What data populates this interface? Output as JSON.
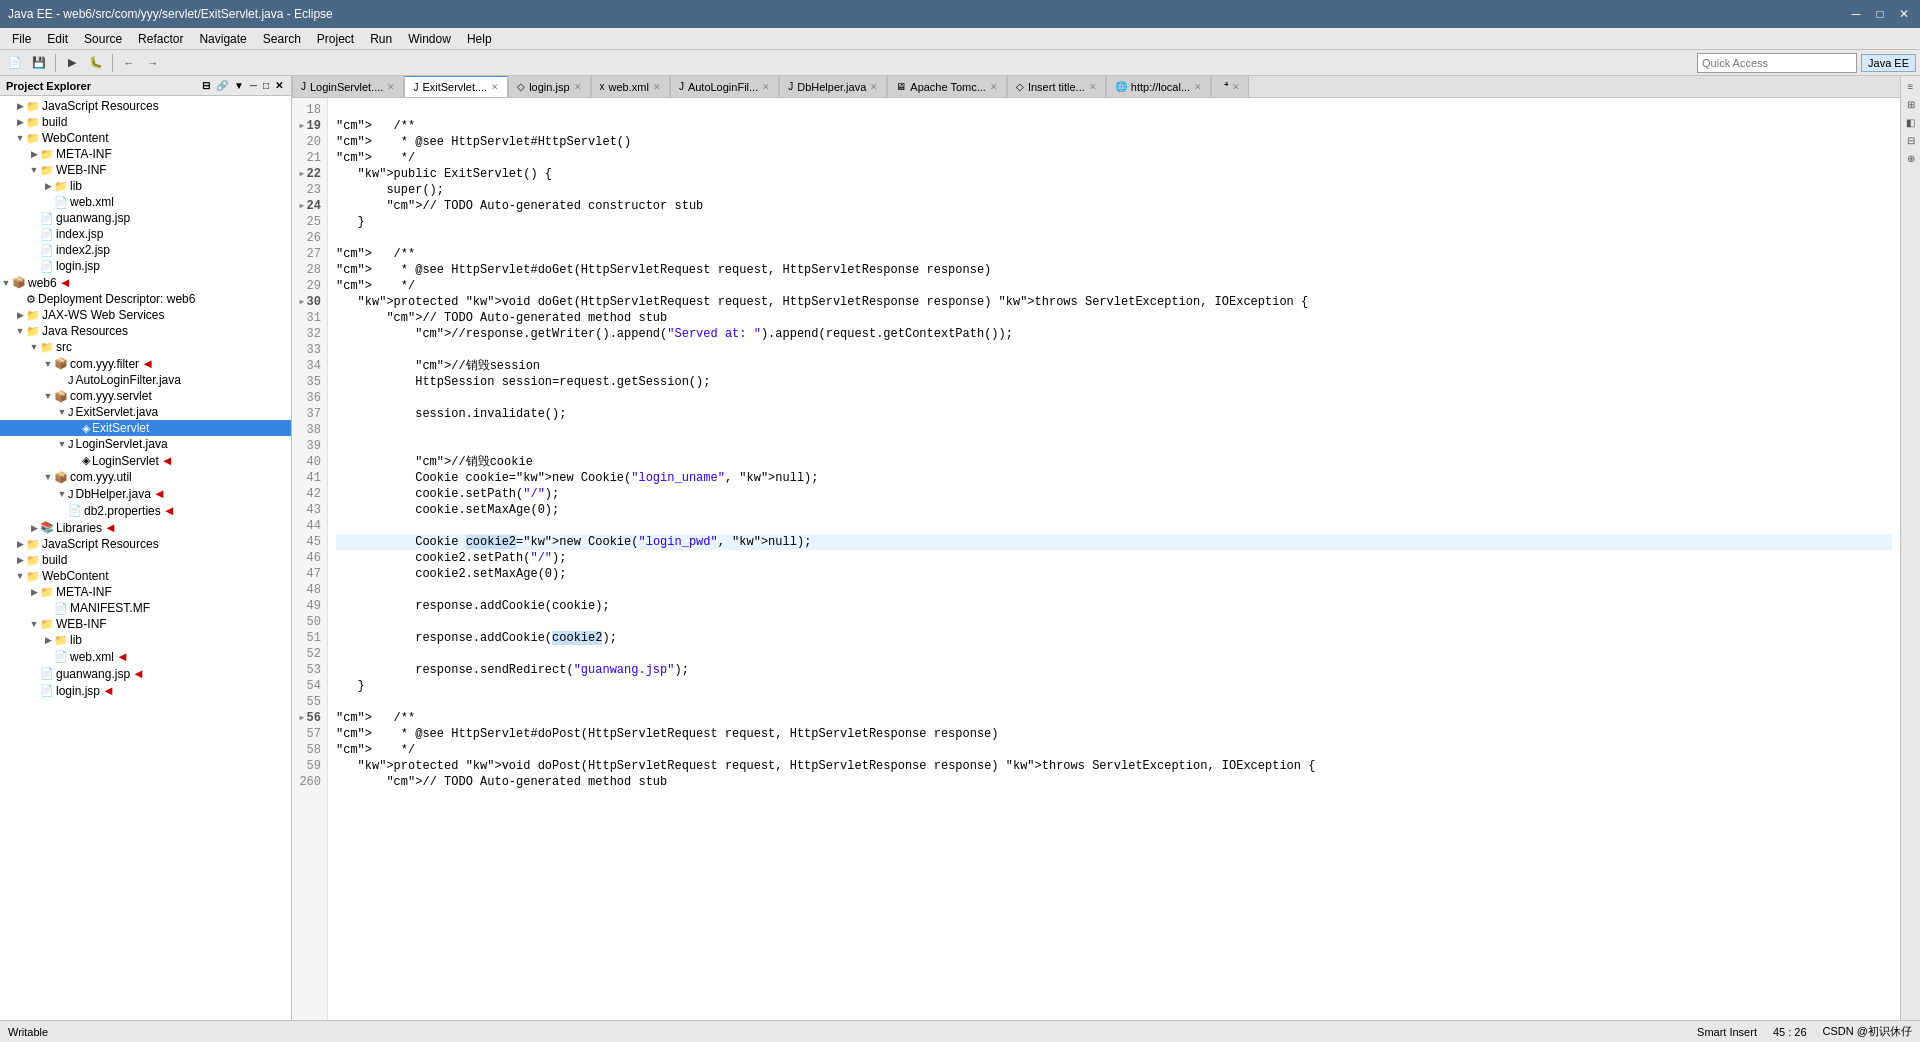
{
  "titleBar": {
    "title": "Java EE - web6/src/com/yyy/servlet/ExitServlet.java - Eclipse",
    "minimize": "─",
    "maximize": "□",
    "close": "✕"
  },
  "menuBar": {
    "items": [
      "File",
      "Edit",
      "Source",
      "Refactor",
      "Navigate",
      "Search",
      "Project",
      "Run",
      "Window",
      "Help"
    ]
  },
  "toolbar": {
    "quickAccess": "Quick Access",
    "perspectiveBtn": "Java EE"
  },
  "sidebar": {
    "title": "Project Explorer",
    "closeLabel": "✕"
  },
  "tabs": [
    {
      "label": "LoginServlet....",
      "icon": "J",
      "active": false
    },
    {
      "label": "ExitServlet....",
      "icon": "J",
      "active": true
    },
    {
      "label": "login.jsp",
      "icon": "◇",
      "active": false
    },
    {
      "label": "web.xml",
      "icon": "x",
      "active": false
    },
    {
      "label": "AutoLoginFil...",
      "icon": "J",
      "active": false
    },
    {
      "label": "DbHelper.java",
      "icon": "J",
      "active": false
    },
    {
      "label": "Apache Tomc...",
      "icon": "🖥",
      "active": false
    },
    {
      "label": "Insert title...",
      "icon": "◇",
      "active": false
    },
    {
      "label": "http://local...",
      "icon": "🌐",
      "active": false
    },
    {
      "label": "⁴",
      "icon": "",
      "active": false
    }
  ],
  "statusBar": {
    "writable": "Writable",
    "insertMode": "Smart Insert",
    "position": "45 : 26",
    "extra": "CSDN @初识休仔"
  },
  "codeLines": [
    {
      "num": "18",
      "code": ""
    },
    {
      "num": "19",
      "marker": true,
      "code": "   /**"
    },
    {
      "num": "20",
      "code": "    * @see HttpServlet#HttpServlet()"
    },
    {
      "num": "21",
      "code": "    */"
    },
    {
      "num": "22",
      "marker": true,
      "code": "   public ExitServlet() {"
    },
    {
      "num": "23",
      "code": "       super();"
    },
    {
      "num": "24",
      "marker": true,
      "code": "       // TODO Auto-generated constructor stub"
    },
    {
      "num": "25",
      "code": "   }"
    },
    {
      "num": "26",
      "code": ""
    },
    {
      "num": "27",
      "code": "   /**"
    },
    {
      "num": "28",
      "code": "    * @see HttpServlet#doGet(HttpServletRequest request, HttpServletResponse response)"
    },
    {
      "num": "29",
      "code": "    */"
    },
    {
      "num": "30",
      "marker": true,
      "code": "   protected void doGet(HttpServletRequest request, HttpServletResponse response) throws ServletException, IOException {"
    },
    {
      "num": "31",
      "code": "       // TODO Auto-generated method stub"
    },
    {
      "num": "32",
      "code": "           //response.getWriter().append(\"Served at: \").append(request.getContextPath());"
    },
    {
      "num": "33",
      "code": ""
    },
    {
      "num": "34",
      "code": "           //销毁session"
    },
    {
      "num": "35",
      "code": "           HttpSession session=request.getSession();"
    },
    {
      "num": "36",
      "code": ""
    },
    {
      "num": "37",
      "code": "           session.invalidate();"
    },
    {
      "num": "38",
      "code": ""
    },
    {
      "num": "39",
      "code": ""
    },
    {
      "num": "40",
      "code": "           //销毁cookie"
    },
    {
      "num": "41",
      "code": "           Cookie cookie=new Cookie(\"login_uname\", null);"
    },
    {
      "num": "42",
      "code": "           cookie.setPath(\"/\");"
    },
    {
      "num": "43",
      "code": "           cookie.setMaxAge(0);"
    },
    {
      "num": "44",
      "code": ""
    },
    {
      "num": "45",
      "code": "           Cookie cookie2=new Cookie(\"login_pwd\", null);",
      "highlighted": true
    },
    {
      "num": "46",
      "code": "           cookie2.setPath(\"/\");"
    },
    {
      "num": "47",
      "code": "           cookie2.setMaxAge(0);"
    },
    {
      "num": "48",
      "code": ""
    },
    {
      "num": "49",
      "code": "           response.addCookie(cookie);"
    },
    {
      "num": "50",
      "code": ""
    },
    {
      "num": "51",
      "code": "           response.addCookie(cookie2);"
    },
    {
      "num": "52",
      "code": ""
    },
    {
      "num": "53",
      "code": "           response.sendRedirect(\"guanwang.jsp\");"
    },
    {
      "num": "54",
      "code": "   }"
    },
    {
      "num": "55",
      "code": ""
    },
    {
      "num": "56",
      "marker": true,
      "code": "   /**"
    },
    {
      "num": "57",
      "code": "    * @see HttpServlet#doPost(HttpServletRequest request, HttpServletResponse response)"
    },
    {
      "num": "58",
      "code": "    */"
    },
    {
      "num": "59",
      "code": "   protected void doPost(HttpServletRequest request, HttpServletResponse response) throws ServletException, IOException {"
    },
    {
      "num": "260",
      "code": "       // TODO Auto-generated method stub"
    }
  ],
  "treeItems": [
    {
      "id": "js-res-1",
      "indent": 1,
      "arrow": "▶",
      "icon": "📁",
      "label": "JavaScript Resources"
    },
    {
      "id": "build-1",
      "indent": 1,
      "arrow": "▶",
      "icon": "📁",
      "label": "build"
    },
    {
      "id": "webcontent-1",
      "indent": 1,
      "arrow": "▼",
      "icon": "📁",
      "label": "WebContent"
    },
    {
      "id": "meta-inf-1",
      "indent": 2,
      "arrow": "▶",
      "icon": "📁",
      "label": "META-INF"
    },
    {
      "id": "web-inf-1",
      "indent": 2,
      "arrow": "▼",
      "icon": "📁",
      "label": "WEB-INF"
    },
    {
      "id": "lib-1",
      "indent": 3,
      "arrow": "▶",
      "icon": "📁",
      "label": "lib"
    },
    {
      "id": "webxml-1",
      "indent": 3,
      "arrow": "",
      "icon": "📄",
      "label": "web.xml"
    },
    {
      "id": "guanwang-1",
      "indent": 2,
      "arrow": "",
      "icon": "📄",
      "label": "guanwang.jsp"
    },
    {
      "id": "index-1",
      "indent": 2,
      "arrow": "",
      "icon": "📄",
      "label": "index.jsp"
    },
    {
      "id": "index2-1",
      "indent": 2,
      "arrow": "",
      "icon": "📄",
      "label": "index2.jsp"
    },
    {
      "id": "login-1",
      "indent": 2,
      "arrow": "",
      "icon": "📄",
      "label": "login.jsp"
    },
    {
      "id": "web6",
      "indent": 0,
      "arrow": "▼",
      "icon": "📦",
      "label": "web6",
      "arrow_red": true
    },
    {
      "id": "deploy-desc",
      "indent": 1,
      "arrow": "",
      "icon": "⚙",
      "label": "Deployment Descriptor: web6"
    },
    {
      "id": "jax-ws",
      "indent": 1,
      "arrow": "▶",
      "icon": "📁",
      "label": "JAX-WS Web Services"
    },
    {
      "id": "java-res",
      "indent": 1,
      "arrow": "▼",
      "icon": "📁",
      "label": "Java Resources"
    },
    {
      "id": "src",
      "indent": 2,
      "arrow": "▼",
      "icon": "📁",
      "label": "src"
    },
    {
      "id": "com-yyy-filter",
      "indent": 3,
      "arrow": "▼",
      "icon": "📦",
      "label": "com.yyy.filter",
      "arrow_red": true
    },
    {
      "id": "autologin-filter",
      "indent": 4,
      "arrow": "",
      "icon": "J",
      "label": "AutoLoginFilter.java"
    },
    {
      "id": "com-yyy-servlet",
      "indent": 3,
      "arrow": "▼",
      "icon": "📦",
      "label": "com.yyy.servlet"
    },
    {
      "id": "exitservlet-java",
      "indent": 4,
      "arrow": "▼",
      "icon": "J",
      "label": "ExitServlet.java"
    },
    {
      "id": "exitservlet",
      "indent": 5,
      "arrow": "",
      "icon": "◈",
      "label": "ExitServlet",
      "selected": true
    },
    {
      "id": "loginservlet-java",
      "indent": 4,
      "arrow": "▼",
      "icon": "J",
      "label": "LoginServlet.java"
    },
    {
      "id": "loginservlet",
      "indent": 5,
      "arrow": "",
      "icon": "◈",
      "label": "LoginServlet",
      "arrow_red": true
    },
    {
      "id": "com-yyy-util",
      "indent": 3,
      "arrow": "▼",
      "icon": "📦",
      "label": "com.yyy.util"
    },
    {
      "id": "dbhelper-java",
      "indent": 4,
      "arrow": "▼",
      "icon": "J",
      "label": "DbHelper.java",
      "arrow_red": true
    },
    {
      "id": "db2-props",
      "indent": 4,
      "arrow": "",
      "icon": "📄",
      "label": "db2.properties",
      "arrow_red": true
    },
    {
      "id": "libraries",
      "indent": 2,
      "arrow": "▶",
      "icon": "📚",
      "label": "Libraries",
      "arrow_red": true
    },
    {
      "id": "js-res-2",
      "indent": 1,
      "arrow": "▶",
      "icon": "📁",
      "label": "JavaScript Resources"
    },
    {
      "id": "build-2",
      "indent": 1,
      "arrow": "▶",
      "icon": "📁",
      "label": "build"
    },
    {
      "id": "webcontent-2",
      "indent": 1,
      "arrow": "▼",
      "icon": "📁",
      "label": "WebContent"
    },
    {
      "id": "meta-inf-2",
      "indent": 2,
      "arrow": "▶",
      "icon": "📁",
      "label": "META-INF"
    },
    {
      "id": "manifest",
      "indent": 3,
      "arrow": "",
      "icon": "📄",
      "label": "MANIFEST.MF"
    },
    {
      "id": "web-inf-2",
      "indent": 2,
      "arrow": "▼",
      "icon": "📁",
      "label": "WEB-INF"
    },
    {
      "id": "lib-2",
      "indent": 3,
      "arrow": "▶",
      "icon": "📁",
      "label": "lib"
    },
    {
      "id": "webxml-2",
      "indent": 3,
      "arrow": "",
      "icon": "📄",
      "label": "web.xml",
      "arrow_red": true
    },
    {
      "id": "guanwang-2",
      "indent": 2,
      "arrow": "",
      "icon": "📄",
      "label": "guanwang.jsp",
      "arrow_red": true
    },
    {
      "id": "login-2",
      "indent": 2,
      "arrow": "",
      "icon": "📄",
      "label": "login.jsp",
      "arrow_red": true
    }
  ]
}
